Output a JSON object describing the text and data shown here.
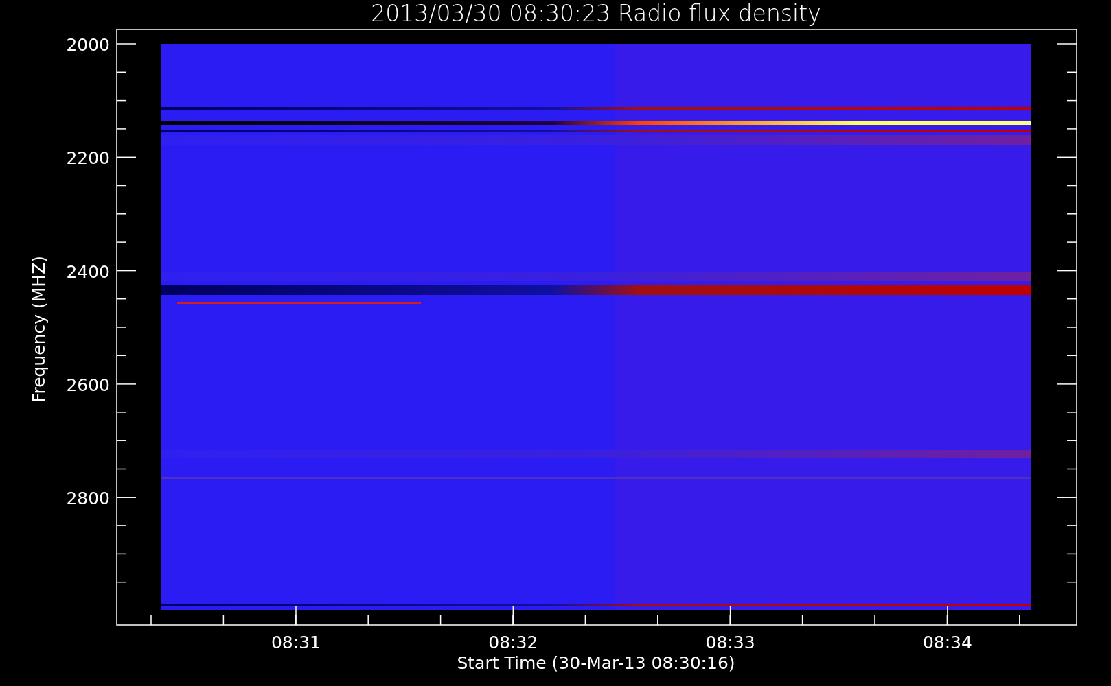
{
  "title": "2013/03/30 08:30:23 Radio flux density",
  "y_axis": {
    "label": "Frequency (MHZ)",
    "tick_labels": [
      "2000",
      "2200",
      "2400",
      "2600",
      "2800"
    ]
  },
  "x_axis": {
    "label": "Start Time (30-Mar-13 08:30:16)",
    "tick_labels": [
      "08:31",
      "08:32",
      "08:33",
      "08:34"
    ]
  }
}
